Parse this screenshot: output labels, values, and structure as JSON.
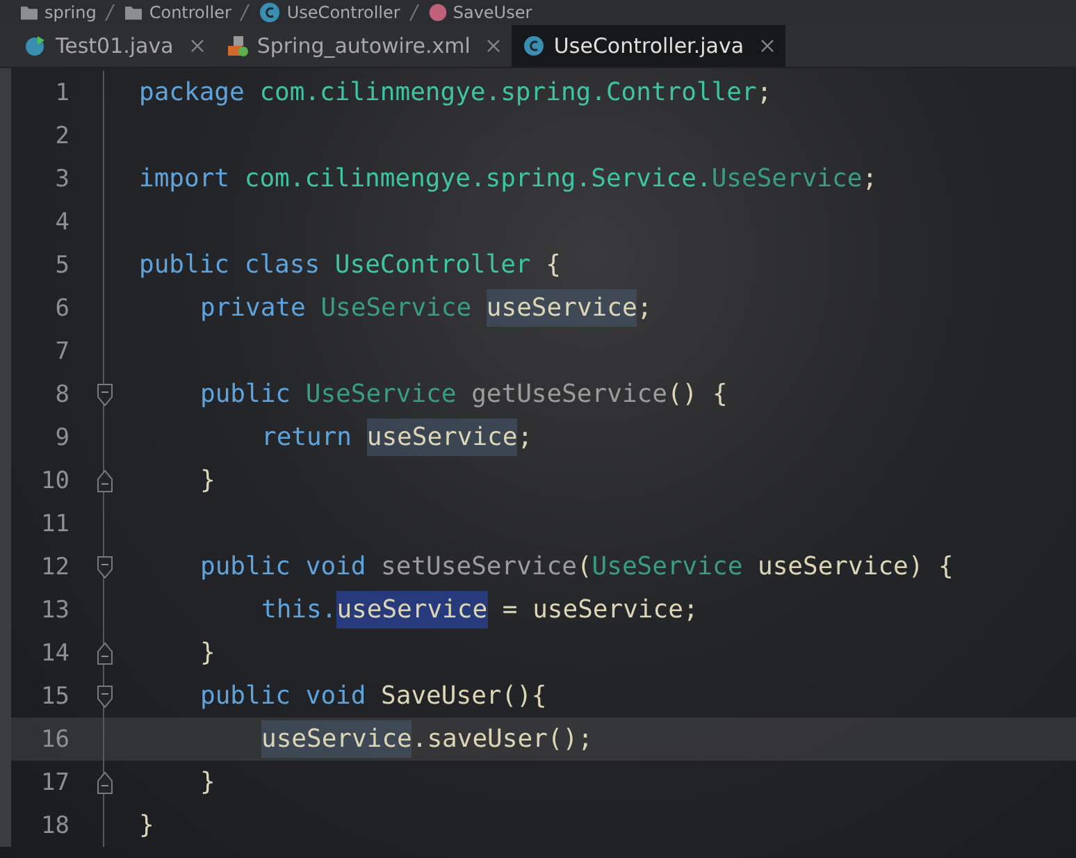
{
  "breadcrumb": [
    {
      "label": "spring",
      "kind": "folder"
    },
    {
      "label": "Controller",
      "kind": "folder"
    },
    {
      "label": "UseController",
      "kind": "class"
    },
    {
      "label": "SaveUser",
      "kind": "method"
    }
  ],
  "tabs": [
    {
      "label": "Test01.java",
      "kind": "runnable",
      "selected": false
    },
    {
      "label": "Spring_autowire.xml",
      "kind": "xml",
      "selected": false
    },
    {
      "label": "UseController.java",
      "kind": "class",
      "selected": true
    }
  ],
  "lines": [
    {
      "number": "1",
      "current": false,
      "tokens": [
        {
          "t": "package ",
          "kind": "keyword"
        },
        {
          "t": "com.cilinmengye.spring.Controller",
          "kind": "package"
        },
        {
          "t": ";",
          "kind": "plain"
        }
      ]
    },
    {
      "number": "2",
      "current": false
    },
    {
      "number": "3",
      "current": false,
      "tokens": [
        {
          "t": "import ",
          "kind": "keyword"
        },
        {
          "t": "com.cilinmengye.spring.Service.",
          "kind": "package"
        },
        {
          "t": "UseService",
          "kind": "type"
        },
        {
          "t": ";",
          "kind": "plain"
        }
      ]
    },
    {
      "number": "4",
      "current": false
    },
    {
      "number": "5",
      "current": false,
      "tokens": [
        {
          "t": "public class ",
          "kind": "keyword"
        },
        {
          "t": "UseController",
          "kind": "package"
        },
        {
          "t": " {",
          "kind": "plain"
        }
      ],
      "children": [
        {
          "number": "6",
          "current": false,
          "tokens": [
            {
              "t": "private ",
              "kind": "keyword"
            },
            {
              "t": "UseService ",
              "kind": "type"
            },
            {
              "t": "useService",
              "kind": "usage"
            },
            {
              "t": ";",
              "kind": "plain"
            }
          ]
        },
        {
          "number": "7",
          "current": false
        },
        {
          "number": "8",
          "kind": "fold-start",
          "current": false,
          "tokens": [
            {
              "t": "public ",
              "kind": "keyword"
            },
            {
              "t": "UseService ",
              "kind": "type"
            },
            {
              "t": "getUseService",
              "kind": "unused"
            },
            {
              "t": "() {",
              "kind": "plain"
            }
          ],
          "children": [
            {
              "number": "9",
              "current": false,
              "tokens": [
                {
                  "t": "return ",
                  "kind": "keyword"
                },
                {
                  "t": "useService",
                  "kind": "usage"
                },
                {
                  "t": ";",
                  "kind": "plain"
                }
              ]
            }
          ]
        },
        {
          "number": "10",
          "kind": "fold-end",
          "current": false,
          "tokens": [
            {
              "t": "}",
              "kind": "plain"
            }
          ]
        },
        {
          "number": "11",
          "current": false
        },
        {
          "number": "12",
          "kind": "fold-start",
          "current": false,
          "tokens": [
            {
              "t": "public void ",
              "kind": "keyword"
            },
            {
              "t": "setUseService",
              "kind": "unused"
            },
            {
              "t": "(",
              "kind": "plain"
            },
            {
              "t": "UseService ",
              "kind": "type"
            },
            {
              "t": "useService) {",
              "kind": "plain"
            }
          ],
          "children": [
            {
              "number": "13",
              "current": false,
              "tokens": [
                {
                  "t": "this.",
                  "kind": "keyword"
                },
                {
                  "t": "useService",
                  "kind": "write-usage"
                },
                {
                  "t": " = useService;",
                  "kind": "plain"
                }
              ]
            }
          ]
        },
        {
          "number": "14",
          "kind": "fold-end",
          "current": false,
          "tokens": [
            {
              "t": "}",
              "kind": "plain"
            }
          ]
        },
        {
          "number": "15",
          "kind": "fold-start",
          "current": false,
          "tokens": [
            {
              "t": "public void ",
              "kind": "keyword"
            },
            {
              "t": "SaveUser(){",
              "kind": "plain"
            }
          ],
          "children": [
            {
              "number": "16",
              "current": true,
              "tokens": [
                {
                  "t": "useService",
                  "kind": "usage"
                },
                {
                  "t": ".saveUser();",
                  "kind": "plain"
                }
              ]
            }
          ]
        },
        {
          "number": "17",
          "kind": "fold-end",
          "current": false,
          "tokens": [
            {
              "t": "}",
              "kind": "plain"
            }
          ]
        }
      ]
    },
    {
      "number": "18",
      "current": false,
      "tokens": [
        {
          "t": "}",
          "kind": "plain"
        }
      ]
    }
  ]
}
